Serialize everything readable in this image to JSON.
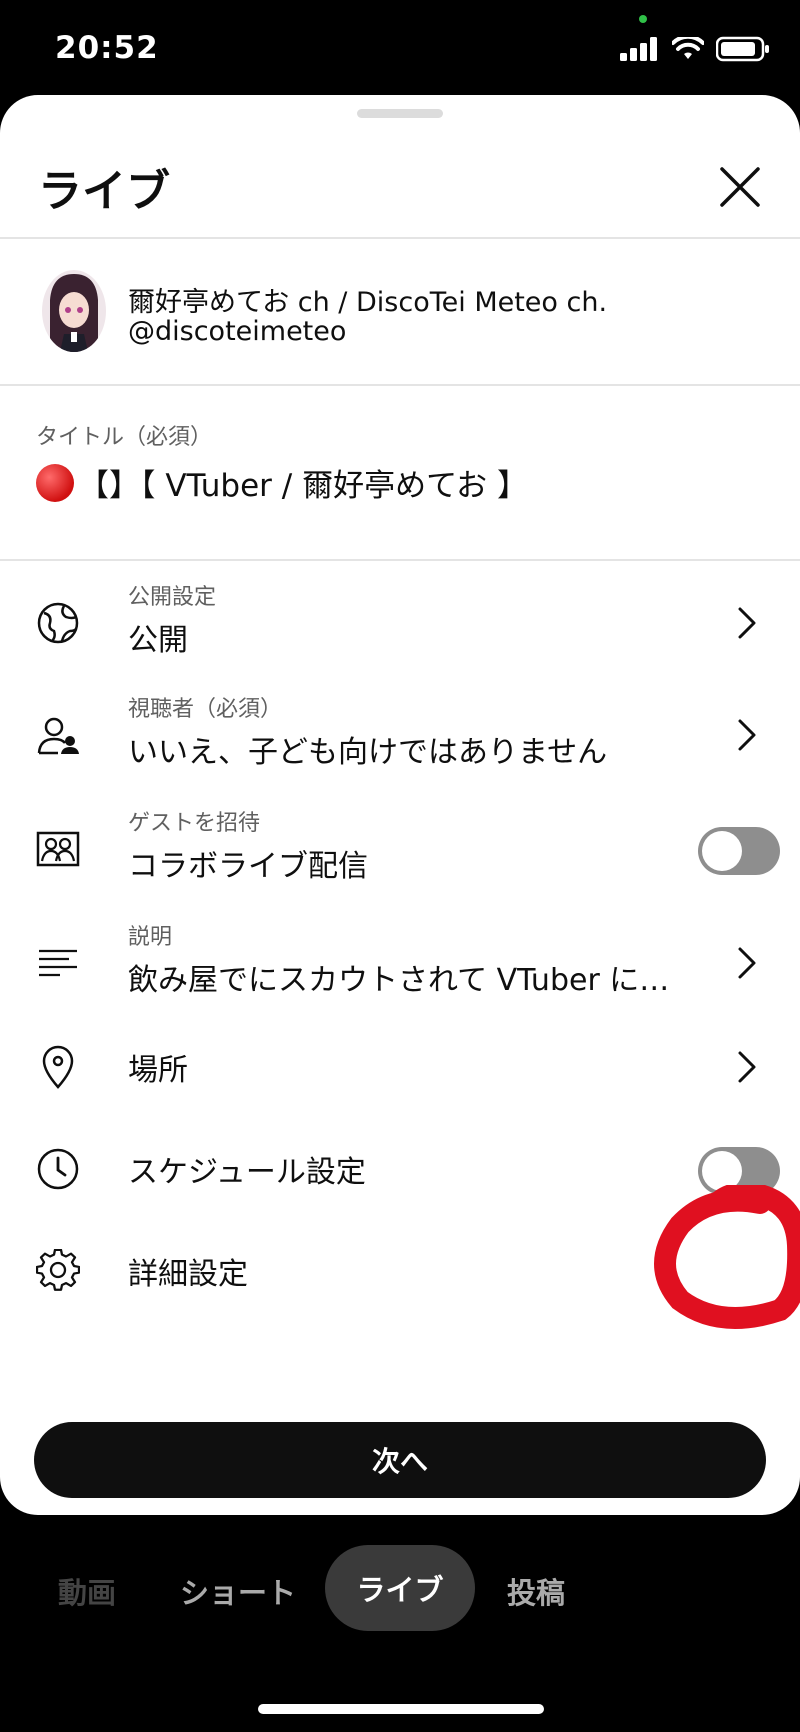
{
  "status_bar": {
    "time": "20:52"
  },
  "sheet": {
    "title": "ライブ"
  },
  "channel": {
    "name": "爾好亭めてお ch / DiscoTei Meteo ch.",
    "handle": "@discoteimeteo"
  },
  "title_field": {
    "label": "タイトル（必須）",
    "value": "【】【 VTuber / 爾好亭めてお 】"
  },
  "settings": [
    {
      "sub": "公開設定",
      "main": "公開",
      "icon": "globe-icon",
      "control": "chevron"
    },
    {
      "sub": "視聴者（必須）",
      "main": "いいえ、子ども向けではありません",
      "icon": "audience-icon",
      "control": "chevron"
    },
    {
      "sub": "ゲストを招待",
      "main": "コラボライブ配信",
      "icon": "guests-icon",
      "control": "toggle",
      "on": false
    },
    {
      "sub": "説明",
      "main": "飲み屋でにスカウトされて VTuber に…",
      "icon": "description-icon",
      "control": "chevron"
    },
    {
      "sub": "",
      "main": "場所",
      "icon": "location-pin-icon",
      "control": "chevron"
    },
    {
      "sub": "",
      "main": "スケジュール設定",
      "icon": "clock-icon",
      "control": "toggle",
      "on": false
    },
    {
      "sub": "",
      "main": "詳細設定",
      "icon": "gear-icon",
      "control": "none"
    }
  ],
  "next_button": "次へ",
  "bottom_tabs": [
    "動画",
    "ショート",
    "ライブ",
    "投稿"
  ],
  "active_tab": "ライブ",
  "colors": {
    "annotation": "#e01020",
    "toggle_off": "#8e8e8e",
    "button": "#0f0f0f"
  }
}
